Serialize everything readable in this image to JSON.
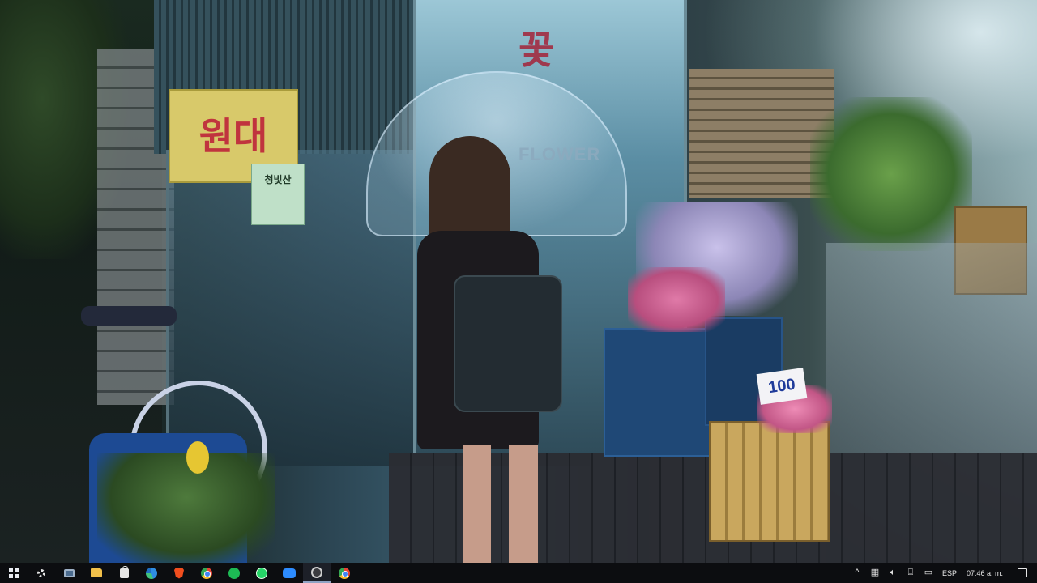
{
  "wallpaper": {
    "scene": "rainy-street-flower-shop",
    "sign_text": "원대",
    "sign2_title": "청빛산",
    "sign2_sub": "",
    "umbrella_text": "FLOWER",
    "storefront_text": "꽃",
    "price_card": "100"
  },
  "taskbar": {
    "apps": [
      {
        "name": "start",
        "icon": "windows-logo-icon"
      },
      {
        "name": "settings",
        "icon": "gear-icon"
      },
      {
        "name": "this-pc",
        "icon": "monitor-icon"
      },
      {
        "name": "file-explorer",
        "icon": "folder-icon"
      },
      {
        "name": "microsoft-store",
        "icon": "shopping-bag-icon"
      },
      {
        "name": "edge",
        "icon": "edge-icon"
      },
      {
        "name": "brave",
        "icon": "brave-lion-icon"
      },
      {
        "name": "chrome",
        "icon": "chrome-icon"
      },
      {
        "name": "spotify",
        "icon": "spotify-icon"
      },
      {
        "name": "whatsapp",
        "icon": "whatsapp-icon"
      },
      {
        "name": "zoom",
        "icon": "zoom-icon"
      },
      {
        "name": "obs",
        "icon": "obs-icon",
        "active": true
      },
      {
        "name": "chrome-2",
        "icon": "chrome-icon"
      }
    ],
    "tray": {
      "chevron_glyph": "^",
      "language": "ESP",
      "clock": "07:46 a. m."
    }
  }
}
